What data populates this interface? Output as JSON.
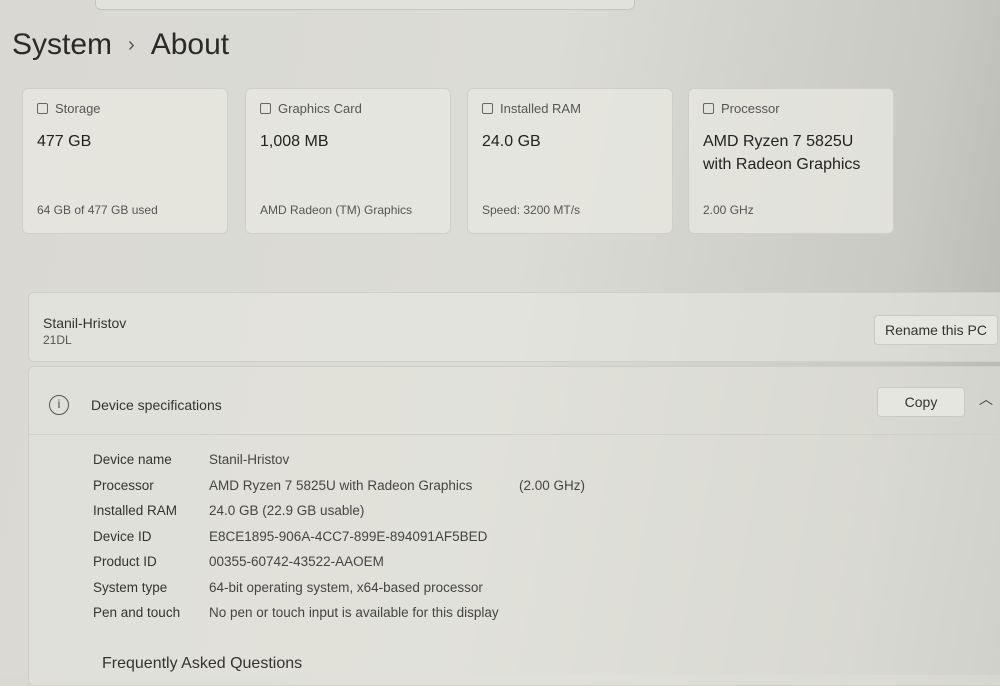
{
  "breadcrumb": {
    "parent": "System",
    "current": "About"
  },
  "cards": [
    {
      "label": "Storage",
      "icon": "storage-icon",
      "value": "477 GB",
      "sub": "64 GB of 477 GB used"
    },
    {
      "label": "Graphics Card",
      "icon": "graphics-card-icon",
      "value": "1,008 MB",
      "sub": "AMD Radeon (TM) Graphics"
    },
    {
      "label": "Installed RAM",
      "icon": "ram-icon",
      "value": "24.0 GB",
      "sub": "Speed: 3200 MT/s"
    },
    {
      "label": "Processor",
      "icon": "processor-icon",
      "value": "AMD Ryzen 7 5825U with Radeon Graphics",
      "sub": "2.00 GHz"
    }
  ],
  "pc": {
    "name": "Stanil-Hristov",
    "model": "21DL",
    "rename": "Rename this PC"
  },
  "specs": {
    "title": "Device specifications",
    "copy": "Copy",
    "rows": [
      {
        "k": "Device name",
        "v": "Stanil-Hristov",
        "x": ""
      },
      {
        "k": "Processor",
        "v": "AMD Ryzen 7 5825U with Radeon Graphics",
        "x": "(2.00 GHz)"
      },
      {
        "k": "Installed RAM",
        "v": "24.0 GB (22.9 GB usable)",
        "x": ""
      },
      {
        "k": "Device ID",
        "v": "E8CE1895-906A-4CC7-899E-894091AF5BED",
        "x": ""
      },
      {
        "k": "Product ID",
        "v": "00355-60742-43522-AAOEM",
        "x": ""
      },
      {
        "k": "System type",
        "v": "64-bit operating system, x64-based processor",
        "x": ""
      },
      {
        "k": "Pen and touch",
        "v": "No pen or touch input is available for this display",
        "x": ""
      }
    ]
  },
  "faq": "Frequently Asked Questions"
}
